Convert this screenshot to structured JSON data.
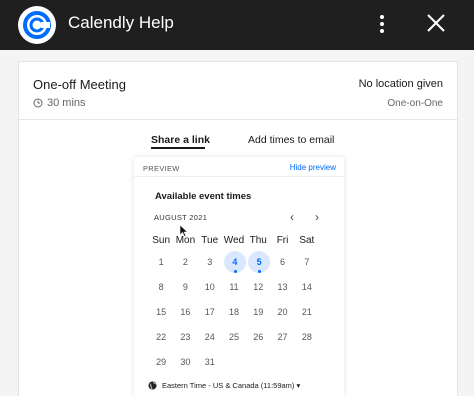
{
  "app": {
    "title": "Calendly Help"
  },
  "colors": {
    "accent": "#006bff",
    "topbar": "#1f1f1f"
  },
  "icons": {
    "logo": "calendly-logo-icon",
    "more": "more-vertical-icon",
    "close": "close-icon",
    "clock": "clock-icon",
    "globe": "globe-icon"
  },
  "meeting": {
    "title": "One-off Meeting",
    "duration": "30 mins",
    "location": "No location given",
    "kind": "One-on-One"
  },
  "tabs": [
    {
      "label": "Share a link",
      "active": true
    },
    {
      "label": "Add times to email",
      "active": false
    }
  ],
  "preview": {
    "label": "PREVIEW",
    "hide_label": "Hide preview",
    "title": "Available event times",
    "month": "AUGUST 2021",
    "prev": "‹",
    "next": "›",
    "days_of_week": [
      "Sun",
      "Mon",
      "Tue",
      "Wed",
      "Thu",
      "Fri",
      "Sat"
    ],
    "weeks": [
      [
        "1",
        "2",
        "3",
        "4",
        "5",
        "6",
        "7"
      ],
      [
        "8",
        "9",
        "10",
        "11",
        "12",
        "13",
        "14"
      ],
      [
        "15",
        "16",
        "17",
        "18",
        "19",
        "20",
        "21"
      ],
      [
        "22",
        "23",
        "24",
        "25",
        "26",
        "27",
        "28"
      ],
      [
        "29",
        "30",
        "31",
        "",
        "",
        "",
        ""
      ]
    ],
    "available_days": [
      "4",
      "5"
    ],
    "timezone": "Eastern Time - US & Canada (11:59am)"
  }
}
